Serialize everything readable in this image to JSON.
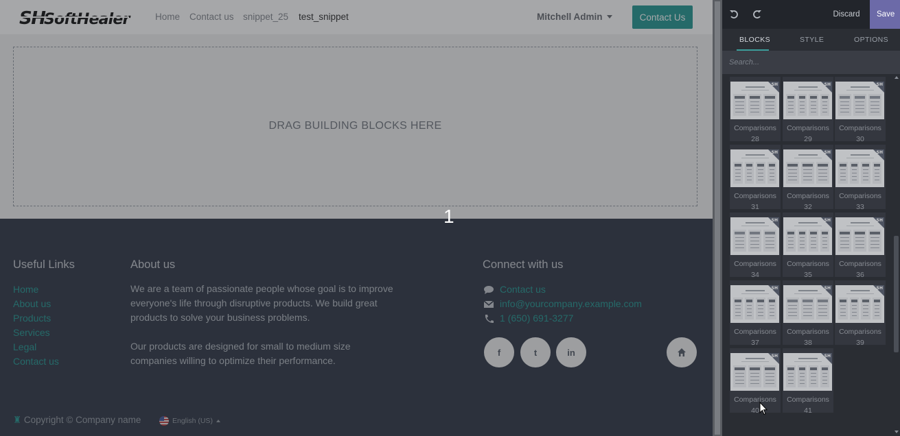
{
  "navbar": {
    "logo_text": "SoftHealer",
    "links": [
      "Home",
      "Contact us",
      "snippet_25",
      "test_snippet"
    ],
    "user_menu": "Mitchell Admin",
    "cta_label": "Contact Us"
  },
  "dropzone": {
    "text": "DRAG BUILDING BLOCKS HERE"
  },
  "page_number": "1",
  "footer": {
    "useful_links_title": "Useful Links",
    "useful_links": [
      "Home",
      "About us",
      "Products",
      "Services",
      "Legal",
      "Contact us"
    ],
    "about_title": "About us",
    "about_p1_line1": "We are a team of passionate people whose goal is to improve",
    "about_p1_line2": "everyone's life through disruptive products. We build great",
    "about_p1_line3": "products to solve your business problems.",
    "about_p2_line1": "Our products are designed for small to medium size",
    "about_p2_line2": "companies willing to optimize their performance.",
    "connect_title": "Connect with us",
    "contact_link": "Contact us",
    "email": "info@yourcompany.example.com",
    "phone": "1 (650) 691-3277",
    "social": {
      "facebook": "f",
      "twitter": "t",
      "linkedin": "in"
    },
    "copyright": "Copyright © Company name",
    "language": "English (US)"
  },
  "editor": {
    "discard_label": "Discard",
    "save_label": "Save",
    "tabs": [
      "BLOCKS",
      "STYLE",
      "OPTIONS"
    ],
    "active_tab": "BLOCKS",
    "search_placeholder": "Search...",
    "blocks": [
      {
        "name": "Comparisons",
        "num": "28"
      },
      {
        "name": "Comparisons",
        "num": "29"
      },
      {
        "name": "Comparisons",
        "num": "30"
      },
      {
        "name": "Comparisons",
        "num": "31"
      },
      {
        "name": "Comparisons",
        "num": "32"
      },
      {
        "name": "Comparisons",
        "num": "33"
      },
      {
        "name": "Comparisons",
        "num": "34"
      },
      {
        "name": "Comparisons",
        "num": "35"
      },
      {
        "name": "Comparisons",
        "num": "36"
      },
      {
        "name": "Comparisons",
        "num": "37"
      },
      {
        "name": "Comparisons",
        "num": "38"
      },
      {
        "name": "Comparisons",
        "num": "39"
      },
      {
        "name": "Comparisons",
        "num": "40"
      },
      {
        "name": "Comparisons",
        "num": "41"
      }
    ]
  },
  "colors": {
    "accent": "#2f9d98",
    "footer_bg": "#3b4250",
    "editor_bg": "#2e3138",
    "save_bg": "#6c6aa8"
  }
}
